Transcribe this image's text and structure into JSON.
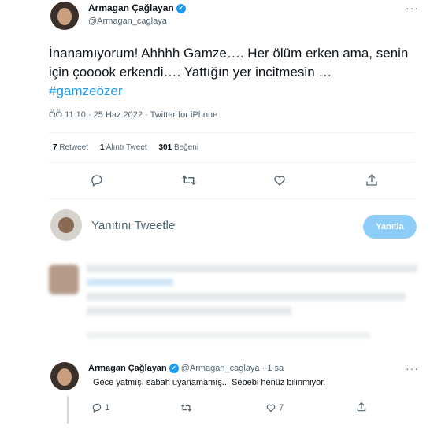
{
  "main_tweet": {
    "name": "Armagan Çağlayan",
    "handle": "@Armagan_caglaya",
    "text_before_tag": "İnanamıyorum! Ahhhh Gamze…. Her ölüm erken ama, senin için çooook erkendi…. Yattığın yer incitmesin …",
    "hashtag": "#gamzeözer",
    "meta": "ÖÖ 11:10 · 25 Haz 2022 · Twitter for iPhone",
    "stats": {
      "retweets_count": "7",
      "retweets_label": "Retweet",
      "quotes_count": "1",
      "quotes_label": "Alıntı Tweet",
      "likes_count": "301",
      "likes_label": "Beğeni"
    },
    "more": "···"
  },
  "compose": {
    "placeholder": "Yanıtını Tweetle",
    "button": "Yanıtla"
  },
  "reply_tweet": {
    "name": "Armagan Çağlayan",
    "handle_time": "@Armagan_caglaya · 1 sa",
    "text": "Gece yatmış, sabah uyanamamış... Sebebi henüz bilinmiyor.",
    "reply_count": "1",
    "like_count": "7",
    "more": "···"
  },
  "icons": {
    "reply": "reply-icon",
    "retweet": "retweet-icon",
    "like": "heart-icon",
    "share": "share-icon",
    "verified": "verified-badge-icon"
  },
  "colors": {
    "accent": "#1d9bf0",
    "button_disabled": "#8ecdf8",
    "secondary_text": "#536471"
  }
}
